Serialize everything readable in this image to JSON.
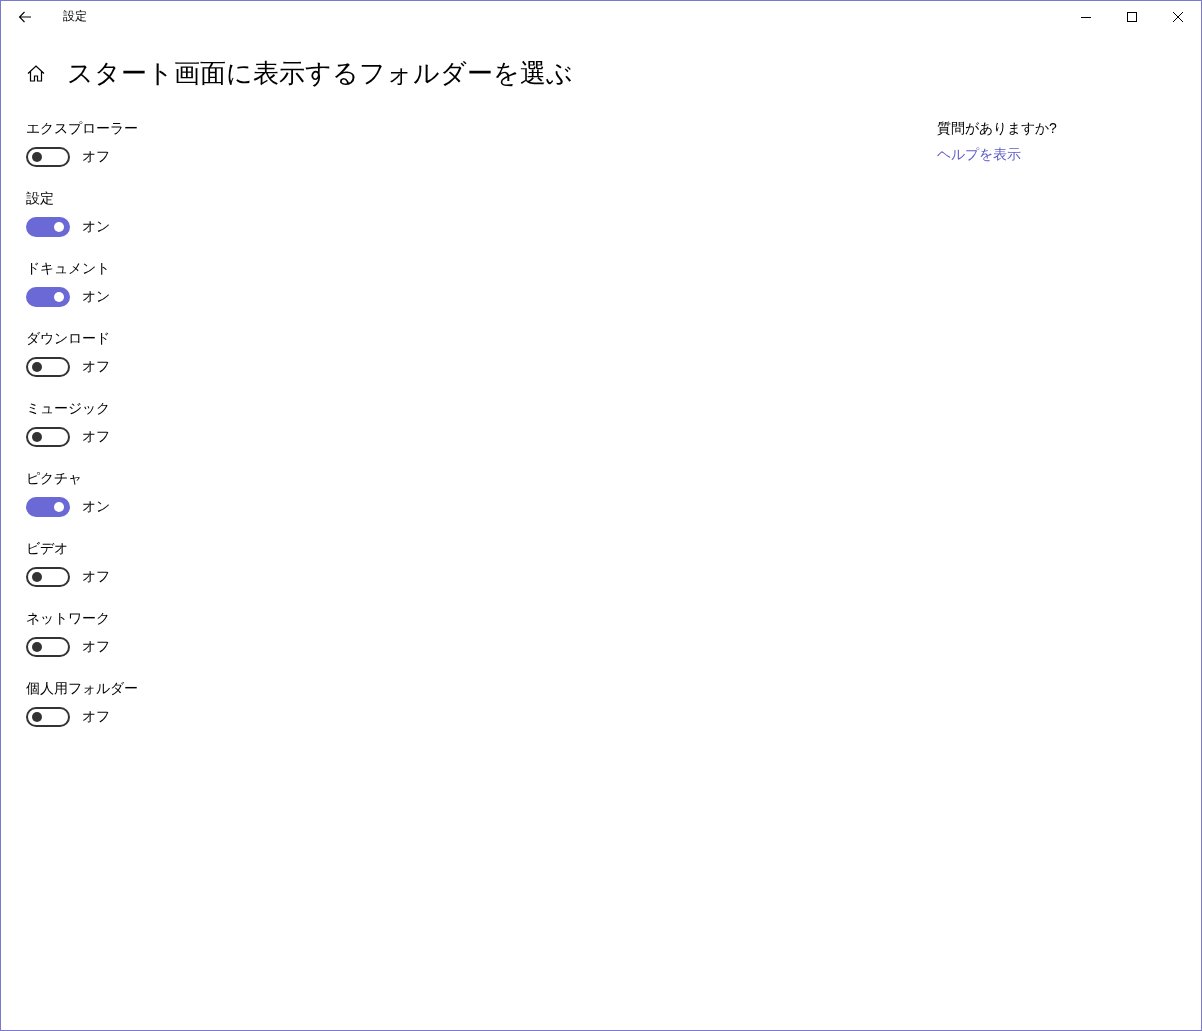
{
  "window": {
    "title": "設定"
  },
  "page": {
    "heading": "スタート画面に表示するフォルダーを選ぶ"
  },
  "toggles": [
    {
      "label": "エクスプローラー",
      "on": false,
      "state_text": "オフ"
    },
    {
      "label": "設定",
      "on": true,
      "state_text": "オン"
    },
    {
      "label": "ドキュメント",
      "on": true,
      "state_text": "オン"
    },
    {
      "label": "ダウンロード",
      "on": false,
      "state_text": "オフ"
    },
    {
      "label": "ミュージック",
      "on": false,
      "state_text": "オフ"
    },
    {
      "label": "ピクチャ",
      "on": true,
      "state_text": "オン"
    },
    {
      "label": "ビデオ",
      "on": false,
      "state_text": "オフ"
    },
    {
      "label": "ネットワーク",
      "on": false,
      "state_text": "オフ"
    },
    {
      "label": "個人用フォルダー",
      "on": false,
      "state_text": "オフ"
    }
  ],
  "help": {
    "question": "質問がありますか?",
    "link": "ヘルプを表示"
  }
}
